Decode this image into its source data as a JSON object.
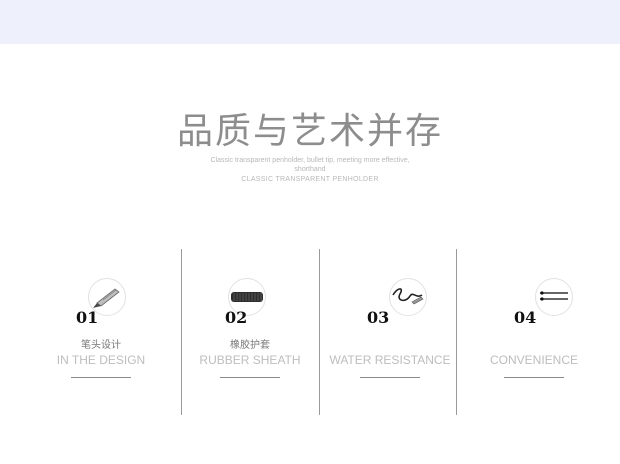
{
  "header": {
    "title": "品质与艺术并存",
    "subtitle_line1": "Classic transparent penholder, bullet tip, meeting more effective,",
    "subtitle_line2": "shorthand",
    "subtitle_line3": "CLASSIC TRANSPARENT PENHOLDER"
  },
  "features": [
    {
      "number": "01",
      "title_cn": "笔头设计",
      "title_en": "IN THE DESIGN",
      "icon": "pen-tip-icon"
    },
    {
      "number": "02",
      "title_cn": "橡胶护套",
      "title_en": "RUBBER SHEATH",
      "icon": "rubber-grip-icon"
    },
    {
      "number": "03",
      "title_cn": "",
      "title_en": "WATER RESISTANCE",
      "icon": "ink-scribble-icon"
    },
    {
      "number": "04",
      "title_cn": "",
      "title_en": "CONVENIENCE",
      "icon": "pen-refill-icon"
    }
  ],
  "colors": {
    "top_band": "#eef0fb",
    "heading": "#8d8d8d",
    "divider": "#9a9a9a"
  }
}
